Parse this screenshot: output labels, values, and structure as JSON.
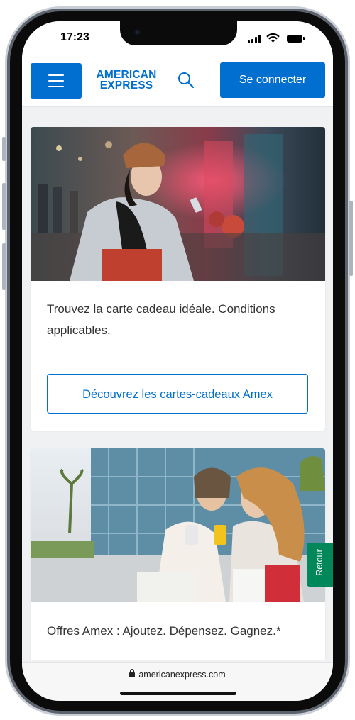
{
  "status_bar": {
    "time": "17:23"
  },
  "header": {
    "logo_line1": "AMERICAN",
    "logo_line2": "EXPRESS",
    "connect_label": "Se connecter",
    "brand_color": "#006fcf"
  },
  "cards": [
    {
      "text": "Trouvez la carte cadeau idéale. Conditions applicables.",
      "button_label": "Découvrez les cartes-cadeaux Amex"
    },
    {
      "text": "Offres Amex : Ajoutez. Dépensez. Gagnez.*"
    }
  ],
  "retour_label": "Retour",
  "url_bar": {
    "url": "americanexpress.com"
  },
  "icons": [
    "menu-icon",
    "search-icon",
    "lock-icon",
    "signal-icon",
    "wifi-icon",
    "battery-icon"
  ],
  "colors": {
    "accent": "#006fcf",
    "retour": "#00875a",
    "background": "#f0f1f3"
  }
}
